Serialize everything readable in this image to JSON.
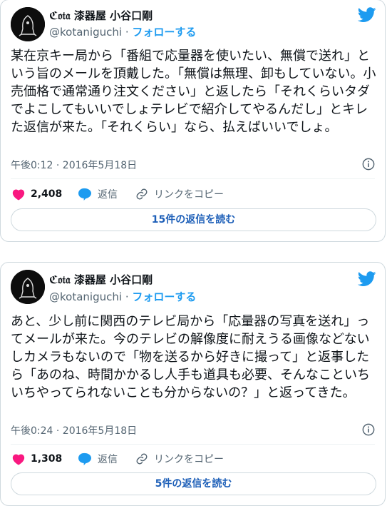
{
  "brand": {
    "accent": "#1d9bf0",
    "heart": "#f91880",
    "text": "#0f1419",
    "muted": "#536471"
  },
  "tweets": [
    {
      "display_name": "ℭ𝔬𝔱𝔞 漆器屋 小谷口剛",
      "handle": "@kotaniguchi",
      "separator": "·",
      "follow_label": "フォローする",
      "text": "某在京キー局から「番組で応量器を使いたい、無償で送れ」という旨のメールを頂戴した。「無償は無理、卸もしていない。小売価格で通常通り注文ください」と返したら「それくらいタダでよこしてもいいでしょテレビで紹介してやるんだし」とキレた返信が来た。「それくらい」なら、払えばいいでしょ。",
      "timestamp": "午後0:12 · 2016年5月18日",
      "like_count": "2,408",
      "reply_label": "返信",
      "copy_link_label": "リンクをコピー",
      "replies_button": "15件の返信を読む",
      "icons": {
        "bird": "twitter-bird-icon",
        "info": "info-icon",
        "like": "heart-icon",
        "reply": "reply-bubble-icon",
        "link": "link-icon"
      }
    },
    {
      "display_name": "ℭ𝔬𝔱𝔞 漆器屋 小谷口剛",
      "handle": "@kotaniguchi",
      "separator": "·",
      "follow_label": "フォローする",
      "text": "あと、少し前に関西のテレビ局から「応量器の写真を送れ」ってメールが来た。今のテレビの解像度に耐えうる画像などないしカメラもないので「物を送るから好きに撮って」と返事したら「あのね、時間かかるし人手も道具も必要、そんなこといちいちやってられないことも分からないの？」と返ってきた。",
      "timestamp": "午後0:24 · 2016年5月18日",
      "like_count": "1,308",
      "reply_label": "返信",
      "copy_link_label": "リンクをコピー",
      "replies_button": "5件の返信を読む",
      "icons": {
        "bird": "twitter-bird-icon",
        "info": "info-icon",
        "like": "heart-icon",
        "reply": "reply-bubble-icon",
        "link": "link-icon"
      }
    }
  ]
}
